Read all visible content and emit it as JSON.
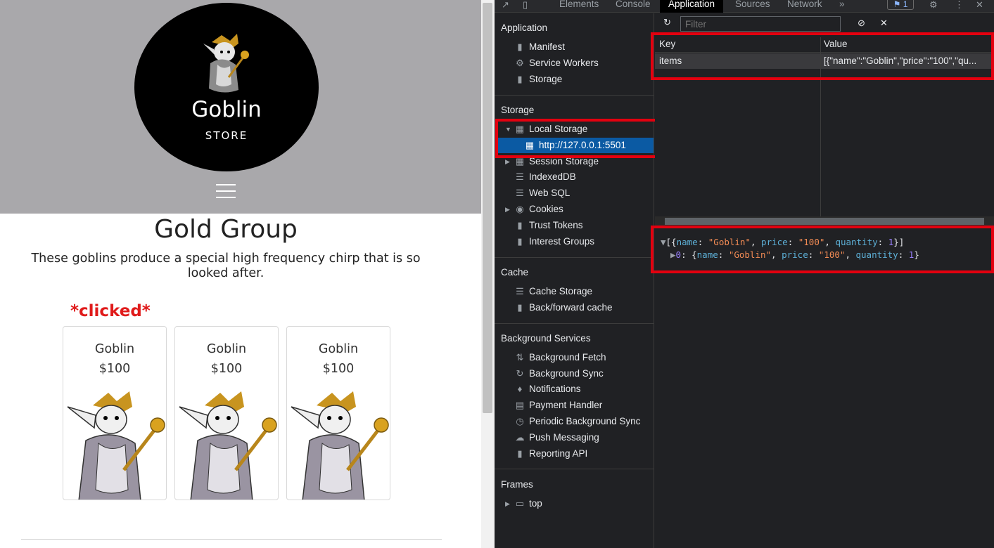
{
  "store": {
    "logo_title": "Goblin",
    "logo_subtitle": "STORE",
    "group_title": "Gold Group",
    "group_description": "These goblins produce a special high frequency chirp that is so looked after.",
    "annotation": "*clicked*",
    "products": [
      {
        "name": "Goblin",
        "price": "$100"
      },
      {
        "name": "Goblin",
        "price": "$100"
      },
      {
        "name": "Goblin",
        "price": "$100"
      }
    ]
  },
  "devtools": {
    "tabs": [
      "Elements",
      "Console",
      "Application",
      "Sources",
      "Network"
    ],
    "more_tabs": "»",
    "issues_count": "1",
    "sidebar": {
      "application_header": "Application",
      "application_items": [
        "Manifest",
        "Service Workers",
        "Storage"
      ],
      "storage_header": "Storage",
      "local_storage": "Local Storage",
      "local_storage_origin": "http://127.0.0.1:5501",
      "storage_items": [
        "Session Storage",
        "IndexedDB",
        "Web SQL",
        "Cookies",
        "Trust Tokens",
        "Interest Groups"
      ],
      "cache_header": "Cache",
      "cache_items": [
        "Cache Storage",
        "Back/forward cache"
      ],
      "background_header": "Background Services",
      "background_items": [
        "Background Fetch",
        "Background Sync",
        "Notifications",
        "Payment Handler",
        "Periodic Background Sync",
        "Push Messaging",
        "Reporting API"
      ],
      "frames_header": "Frames",
      "frames_items": [
        "top"
      ]
    },
    "filter_placeholder": "Filter",
    "table": {
      "key_header": "Key",
      "value_header": "Value",
      "rows": [
        {
          "key": "items",
          "value": "[{\"name\":\"Goblin\",\"price\":\"100\",\"qu..."
        }
      ]
    },
    "preview": {
      "line1_prefix": "[{",
      "line1_k1": "name",
      "line1_v1": "\"Goblin\"",
      "line1_k2": "price",
      "line1_v2": "\"100\"",
      "line1_k3": "quantity",
      "line1_v3": "1",
      "line1_suffix": "}]",
      "line2_index": "0",
      "line2_k1": "name",
      "line2_v1": "\"Goblin\"",
      "line2_k2": "price",
      "line2_v2": "\"100\"",
      "line2_k3": "quantity",
      "line2_v3": "1"
    }
  },
  "colors": {
    "highlight_red": "#e3000f",
    "selection_blue": "#0b5aa3",
    "annotation_red": "#e01b1b"
  }
}
